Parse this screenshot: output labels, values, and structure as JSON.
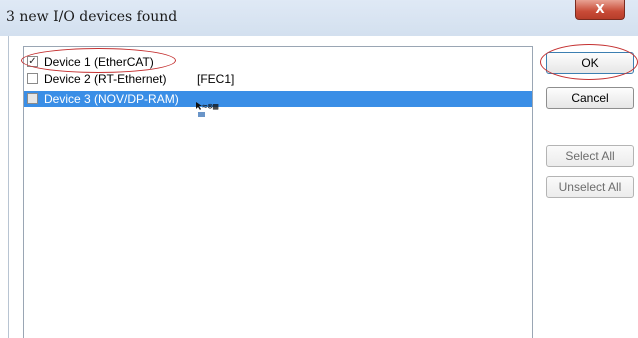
{
  "dialog": {
    "title": "3 new I/O devices found",
    "close_label": "X"
  },
  "devices": [
    {
      "name": "Device 1 (EtherCAT)",
      "adapter": "",
      "checked": true,
      "selected": false
    },
    {
      "name": "Device 2 (RT-Ethernet)",
      "adapter": "[FEC1]",
      "checked": false,
      "selected": false
    },
    {
      "name": "Device 3 (NOV/DP-RAM)",
      "adapter": "",
      "checked": false,
      "selected": true
    }
  ],
  "buttons": {
    "ok": "OK",
    "cancel": "Cancel",
    "select_all": "Select All",
    "unselect_all": "Unselect All"
  },
  "colors": {
    "selection": "#3a8ee6",
    "annotation": "#c43030",
    "close_button": "#c84b37"
  },
  "icons": {
    "close": "close-icon",
    "checkmark": "checkmark-icon",
    "drag_cursor": "drag-copy-cursor-icon"
  }
}
